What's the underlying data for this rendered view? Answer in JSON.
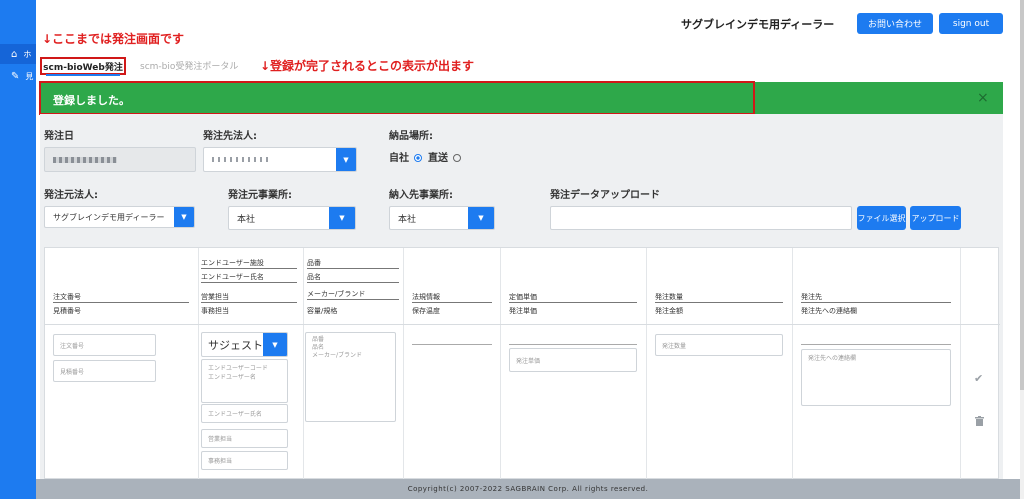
{
  "sidebar": {
    "items": [
      {
        "icon": "home-icon",
        "label": "ホ"
      },
      {
        "icon": "edit-icon",
        "label": "見"
      }
    ]
  },
  "annotations": {
    "top": "↓ここまでは発注画面です",
    "banner": "↓登録が完了されるとこの表示が出ます"
  },
  "header": {
    "dealer_name": "サグブレインデモ用ディーラー",
    "contact_label": "お問い合わせ",
    "signout_label": "sign out"
  },
  "tabs": [
    {
      "label": "scm-bioWeb発注",
      "active": true
    },
    {
      "label": "scm-bio受発注ポータル",
      "active": false
    }
  ],
  "alert": {
    "message": "登録しました。",
    "close": "×"
  },
  "form": {
    "order_date_label": "発注日",
    "order_to_corp_label": "発注先法人:",
    "delivery_place_label": "納品場所:",
    "delivery_options": [
      "自社",
      "直送"
    ],
    "delivery_selected": "自社",
    "order_from_corp_label": "発注元法人:",
    "order_from_corp_value": "サグブレインデモ用ディーラー",
    "order_from_office_label": "発注元事業所:",
    "order_from_office_value": "本社",
    "delivery_office_label": "納入先事業所:",
    "delivery_office_value": "本社",
    "upload_label": "発注データアップロード",
    "file_select_label": "ファイル選択",
    "upload_button_label": "アップロード"
  },
  "table": {
    "headers": {
      "col1": [
        "注文番号",
        "見積番号"
      ],
      "col2": [
        "エンドユーザー施設",
        "エンドユーザー氏名",
        "営業担当",
        "事務担当"
      ],
      "col3": [
        "品番",
        "品名",
        "メーカー/ブランド",
        "容量/規格"
      ],
      "col4": [
        "法規情報",
        "保存温度"
      ],
      "col5": [
        "定価単価",
        "発注単価"
      ],
      "col6": [
        "発注数量",
        "発注金額"
      ],
      "col7": [
        "発注先",
        "発注先への連絡欄"
      ]
    },
    "row": {
      "order_no_ph": "注文番号",
      "quote_no_ph": "見積番号",
      "suggest_value": "サジェスト",
      "enduser_code_ph": "エンドユーザーコード\nエンドユーザー名",
      "enduser_name_ph": "エンドユーザー氏名",
      "sales_ph": "営業担当",
      "office_ph": "事務担当",
      "product_ph": "品番\n品名\nメーカー/ブランド",
      "order_price_ph": "発注単価",
      "quantity_ph": "発注数量",
      "note_ph": "発注先への連絡欄"
    }
  },
  "footer": {
    "copyright": "Copyright(c) 2007-2022 SAGBRAIN Corp. All rights reserved."
  },
  "colors": {
    "primary": "#1d7bf0",
    "success": "#2ea84a",
    "annotation": "#e02020",
    "footer": "#aab2bb"
  }
}
